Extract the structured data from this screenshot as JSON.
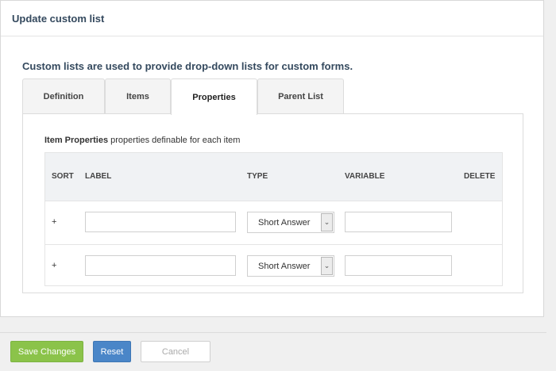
{
  "dialog": {
    "title": "Update custom list",
    "intro": "Custom lists are used to provide drop-down lists for custom forms."
  },
  "tabs": [
    {
      "label": "Definition",
      "active": false
    },
    {
      "label": "Items",
      "active": false
    },
    {
      "label": "Properties",
      "active": true
    },
    {
      "label": "Parent List",
      "active": false
    }
  ],
  "panel": {
    "title_bold": "Item Properties",
    "title_rest": " properties definable for each item"
  },
  "table": {
    "headers": {
      "sort": "SORT",
      "label": "LABEL",
      "type": "TYPE",
      "variable": "VARIABLE",
      "delete": "DELETE"
    },
    "rows": [
      {
        "sort": "+",
        "label_value": "",
        "type": "Short Answer",
        "variable_value": ""
      },
      {
        "sort": "+",
        "label_value": "",
        "type": "Short Answer",
        "variable_value": ""
      }
    ]
  },
  "footer": {
    "save_label": "Save Changes",
    "reset_label": "Reset",
    "cancel_label": "Cancel"
  },
  "colors": {
    "save": "#8bc34a",
    "reset": "#4a86c8",
    "heading": "#34495e"
  }
}
